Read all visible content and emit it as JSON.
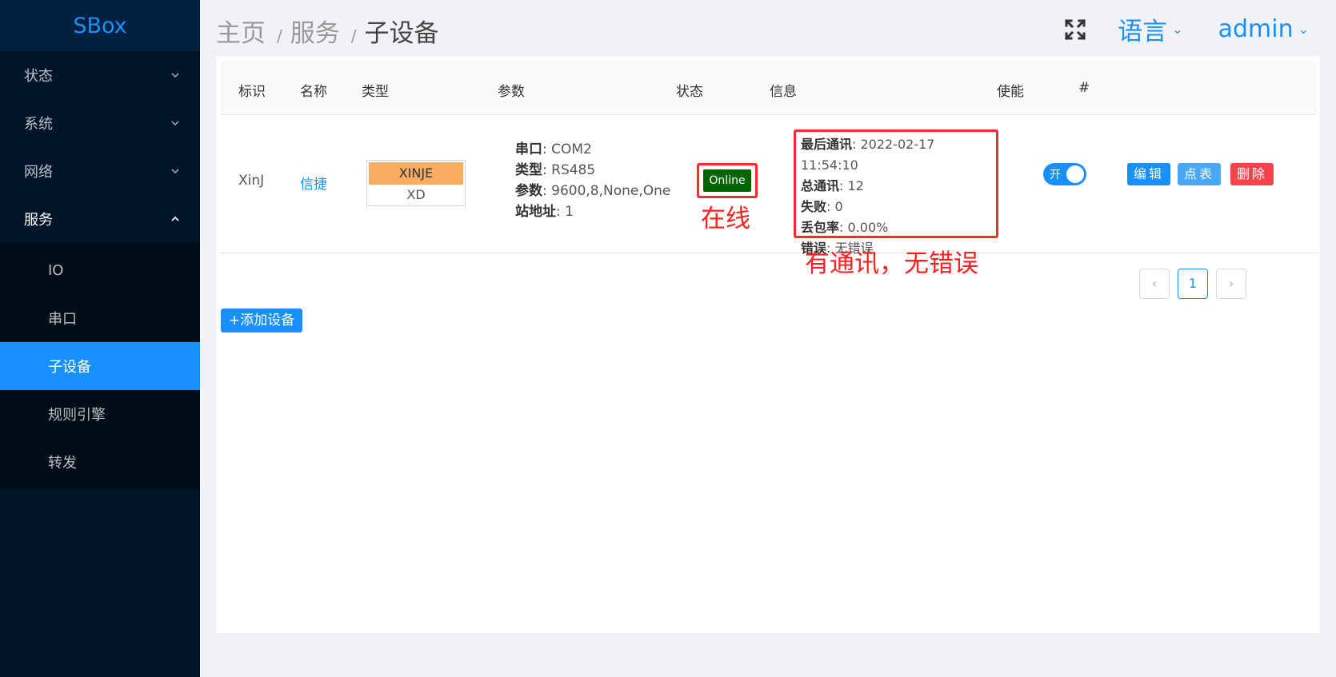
{
  "app": {
    "logo": "SBox"
  },
  "sidebar": {
    "items": [
      {
        "label": "状态"
      },
      {
        "label": "系统"
      },
      {
        "label": "网络"
      },
      {
        "label": "服务"
      }
    ],
    "sub_items": [
      {
        "label": "IO"
      },
      {
        "label": "串口"
      },
      {
        "label": "子设备"
      },
      {
        "label": "规则引擎"
      },
      {
        "label": "转发"
      }
    ],
    "active_sub": "子设备"
  },
  "header": {
    "breadcrumb": [
      "主页",
      "服务",
      "子设备"
    ],
    "separator": "/",
    "language": "语言",
    "user": "admin",
    "caret": "⌄",
    "fullscreen_icon": "fullscreen-icon"
  },
  "table": {
    "columns": [
      "标识",
      "名称",
      "类型",
      "参数",
      "状态",
      "信息",
      "使能",
      "#"
    ],
    "rows": [
      {
        "id": "XinJ",
        "name": "信捷",
        "type_primary": "XINJE",
        "type_secondary": "XD",
        "params": [
          {
            "key": "串口",
            "value": ": COM2"
          },
          {
            "key": "类型",
            "value": ": RS485"
          },
          {
            "key": "参数",
            "value": ": 9600,8,None,One"
          },
          {
            "key": "站地址",
            "value": ": 1"
          }
        ],
        "status": "Online",
        "info": [
          {
            "key": "最后通讯",
            "value": ": 2022-02-17 11:54:10"
          },
          {
            "key": "总通讯",
            "value": ": 12"
          },
          {
            "key": "失败",
            "value": ": 0"
          },
          {
            "key": "丢包率",
            "value": ": 0.00%"
          },
          {
            "key": "错误",
            "value": ": 无错误"
          }
        ],
        "enabled_label": "开",
        "enabled": true,
        "actions": {
          "edit": "编辑",
          "points": "点表",
          "delete": "删除"
        }
      }
    ]
  },
  "annotations": {
    "status_note": "在线",
    "info_note": "有通讯，无错误"
  },
  "pagination": {
    "prev": "‹",
    "current": "1",
    "next": "›"
  },
  "add_button": "+添加设备",
  "colors": {
    "sidebar_bg": "#001529",
    "accent": "#1890ff",
    "online": "#006400",
    "annotation": "#ff2020",
    "delete": "#f5444e",
    "type_tag": "#f8ad61"
  }
}
